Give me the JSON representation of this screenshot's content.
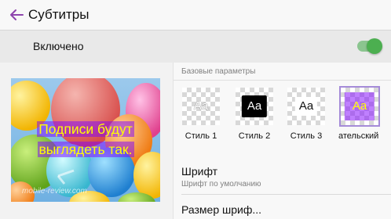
{
  "header": {
    "title": "Субтитры",
    "back_icon": "arrow-left-icon",
    "accent": "#8e44ad"
  },
  "switch": {
    "label": "Включено",
    "state": "on",
    "color": "#4caf50"
  },
  "preview": {
    "caption_line1": "Подписи будут",
    "caption_line2": "выглядеть так.",
    "watermark": "mobile-review.com"
  },
  "settings": {
    "section_title": "Базовые параметры",
    "styles": [
      {
        "label": "Стиль 1",
        "sample": "Aa"
      },
      {
        "label": "Стиль 2",
        "sample": "Aa"
      },
      {
        "label": "Стиль 3",
        "sample": "Aa"
      },
      {
        "label": "ательский",
        "sample": "Aa",
        "selected": true
      }
    ],
    "font": {
      "title": "Шрифт",
      "value": "Шрифт по умолчанию"
    },
    "size": {
      "title": "Размер шриф..."
    }
  }
}
